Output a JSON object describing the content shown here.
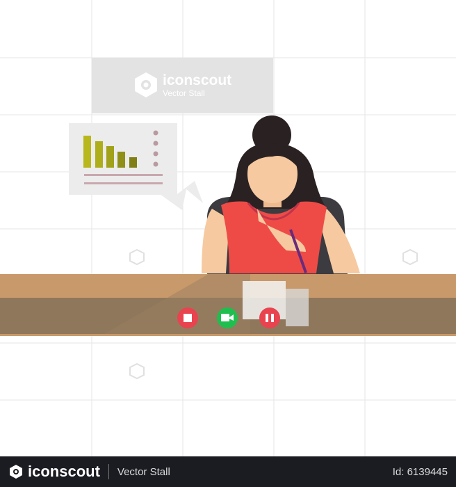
{
  "watermark": {
    "brand": "iconscout",
    "author": "Vector Stall"
  },
  "call_controls": [
    {
      "name": "stop",
      "icon": "stop-icon",
      "color": "#e8434f"
    },
    {
      "name": "video",
      "icon": "video-camera-icon",
      "color": "#1fbf4f"
    },
    {
      "name": "pause",
      "icon": "pause-icon",
      "color": "#e8434f"
    }
  ],
  "footer": {
    "brand": "iconscout",
    "author": "Vector Stall",
    "id_label": "Id: 6139445"
  },
  "colors": {
    "desk_top": "#c8996a",
    "desk_front": "#8f775b",
    "shirt": "#ee4b47",
    "hair": "#2a2122",
    "skin": "#f6c9a0",
    "bars": "#b4b41c"
  }
}
